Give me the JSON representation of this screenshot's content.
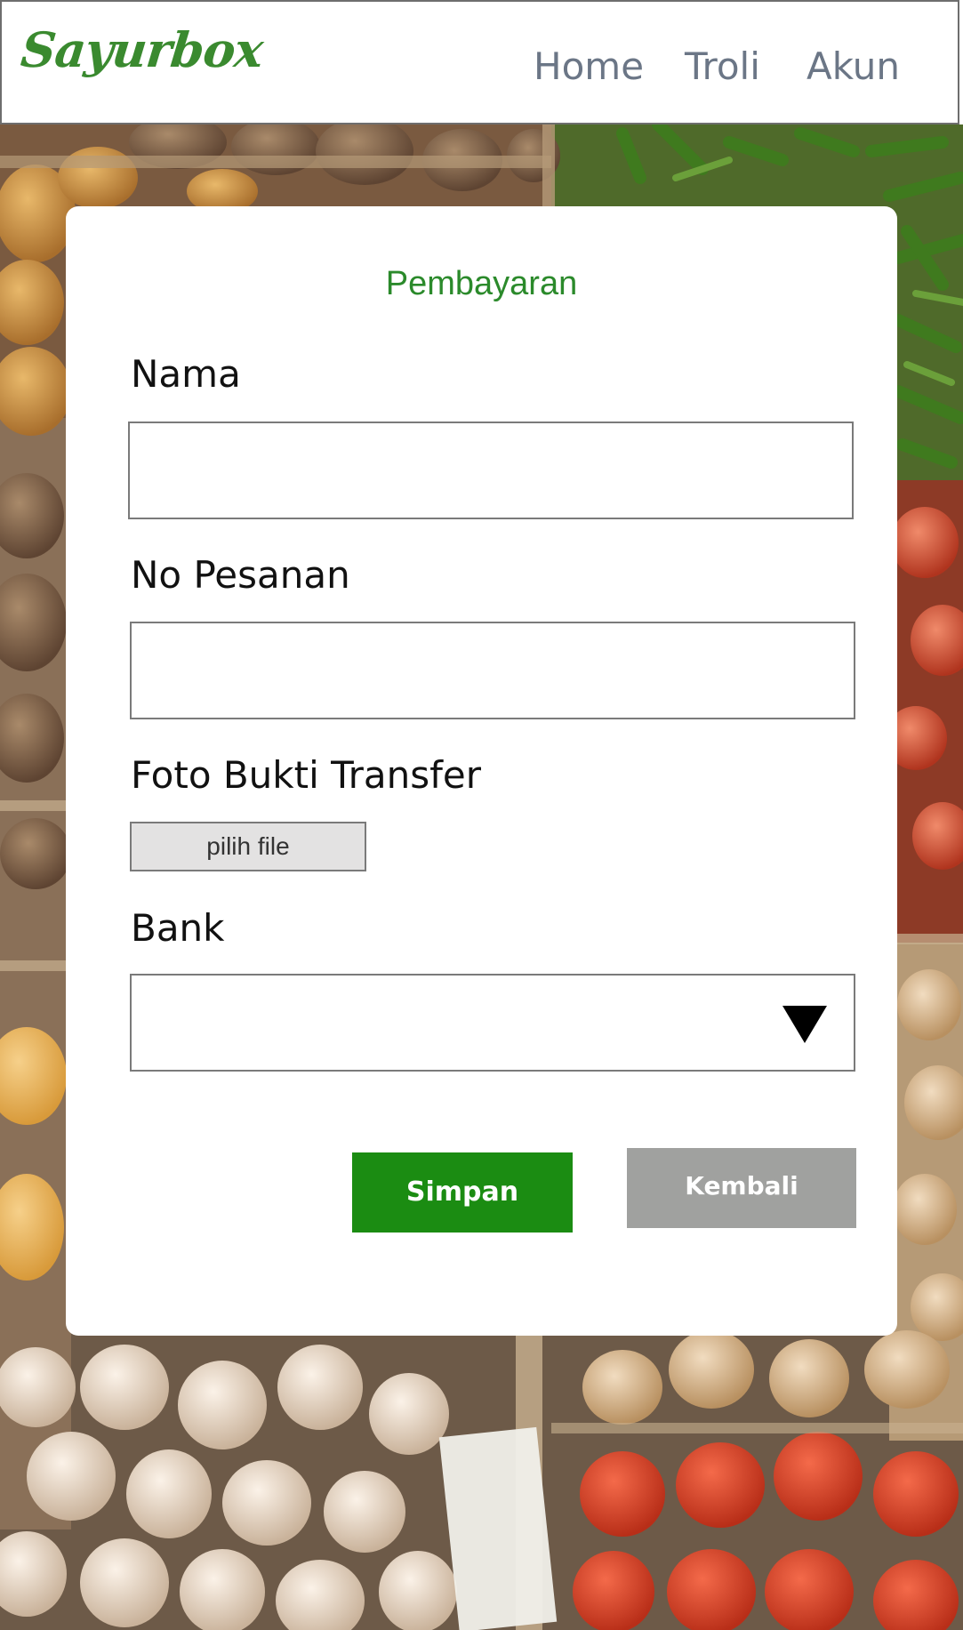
{
  "header": {
    "logo": "Sayurbox",
    "nav": {
      "home": "Home",
      "troli": "Troli",
      "akun": "Akun"
    }
  },
  "form": {
    "title": "Pembayaran",
    "nama_label": "Nama",
    "nama_value": "",
    "pesanan_label": "No Pesanan",
    "pesanan_value": "",
    "foto_label": "Foto Bukti Transfer",
    "file_button": "pilih file",
    "bank_label": "Bank",
    "bank_selected": "",
    "save_label": "Simpan",
    "back_label": "Kembali"
  },
  "colors": {
    "brand_green": "#3a8a2f",
    "title_green": "#2b8a2b",
    "save_button": "#1b8c12",
    "back_button": "#a0a19f",
    "nav_text": "#6b7686"
  }
}
